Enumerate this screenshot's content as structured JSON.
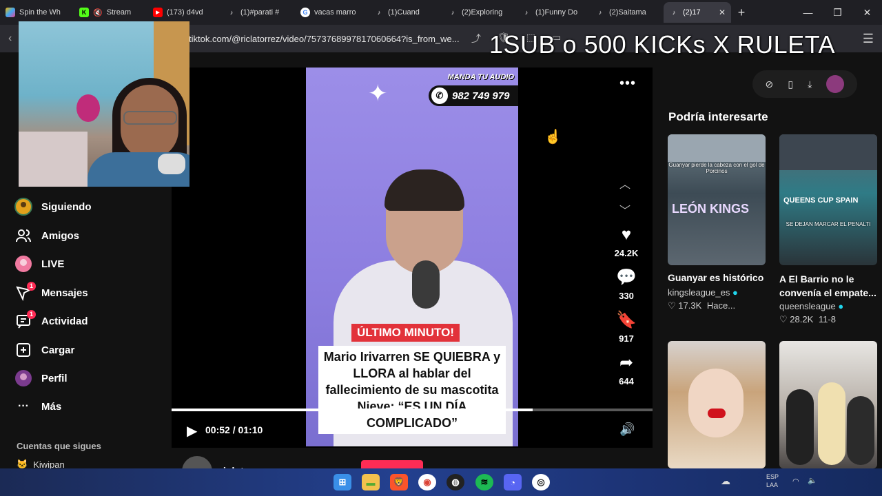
{
  "browser": {
    "tabs": [
      {
        "title": "Spin the Wh",
        "icon": "spin-wheel-icon",
        "color": "#3fa9f5"
      },
      {
        "title": "Stream",
        "icon": "kick-icon",
        "color": "#53fc18"
      },
      {
        "title": "(173) d4vd",
        "icon": "youtube-icon",
        "color": "#ff0000"
      },
      {
        "title": "(1)#parati #",
        "icon": "tiktok-icon",
        "color": "#ffffff"
      },
      {
        "title": "vacas marro",
        "icon": "google-icon",
        "color": "#4285f4"
      },
      {
        "title": "(1)Cuand",
        "icon": "tiktok-icon",
        "color": "#ffffff"
      },
      {
        "title": "(2)Exploring",
        "icon": "tiktok-icon",
        "color": "#ffffff"
      },
      {
        "title": "(1)Funny Do",
        "icon": "tiktok-icon",
        "color": "#ffffff"
      },
      {
        "title": "(2)Saitama",
        "icon": "tiktok-icon",
        "color": "#ffffff"
      },
      {
        "title": "(2)17",
        "icon": "tiktok-icon",
        "color": "#ffffff",
        "active": true
      }
    ],
    "new_tab": "+",
    "url": "tiktok.com/@riclatorrez/video/7573768997817060664?is_from_we..."
  },
  "overlay": {
    "banner": "1SUB o 500 KICKs X RULETA"
  },
  "sidebar": {
    "items": [
      {
        "label": "Siguiendo",
        "icon": "following-avatar-icon"
      },
      {
        "label": "Amigos",
        "icon": "friends-icon"
      },
      {
        "label": "LIVE",
        "icon": "live-avatar-icon"
      },
      {
        "label": "Mensajes",
        "icon": "messages-icon",
        "badge": "1"
      },
      {
        "label": "Actividad",
        "icon": "activity-icon",
        "badge": "1"
      },
      {
        "label": "Cargar",
        "icon": "upload-icon"
      },
      {
        "label": "Perfil",
        "icon": "profile-avatar-icon"
      },
      {
        "label": "Más",
        "icon": "more-icon"
      }
    ],
    "following_section": "Cuentas que sigues",
    "following_first": "Kiwipan"
  },
  "video": {
    "audio_label": "MANDA TU AUDIO",
    "audio_number": "982 749 979",
    "caption_tag": "ÚLTIMO MINUTO!",
    "caption_text": "Mario Irivarren SE QUIEBRA y LLORA al hablar del fallecimiento de su mascotita Nieve: “ES UN DÍA COMPLICADO”",
    "time": "00:52 / 01:10",
    "progress": 0.75,
    "likes": "24.2K",
    "comments": "330",
    "saves": "917",
    "shares": "644",
    "author": "riclatorrez"
  },
  "recommendations": {
    "title": "Podría interesarte",
    "cards": [
      {
        "caption": "Guanyar es histórico",
        "author": "kingsleague_es",
        "likes": "17.3K",
        "date": "Hace...",
        "thumb_text": "Guanyar pierde la cabeza con el gol de Porcinos",
        "thumb_big": "LEÓN KINGS"
      },
      {
        "caption": "A El Barrio no le convenía el empate...",
        "author": "queensleague",
        "likes": "28.2K",
        "date": "11-8",
        "thumb_text": "SE DEJAN MARCAR EL PENALTI",
        "thumb_big": "QUEENS CUP SPAIN"
      },
      {
        "caption": "",
        "author": "",
        "likes": "",
        "date": ""
      },
      {
        "caption": "",
        "author": "",
        "likes": "",
        "date": ""
      }
    ]
  },
  "taskbar": {
    "lang": "ESP",
    "lang2": "LAA"
  }
}
